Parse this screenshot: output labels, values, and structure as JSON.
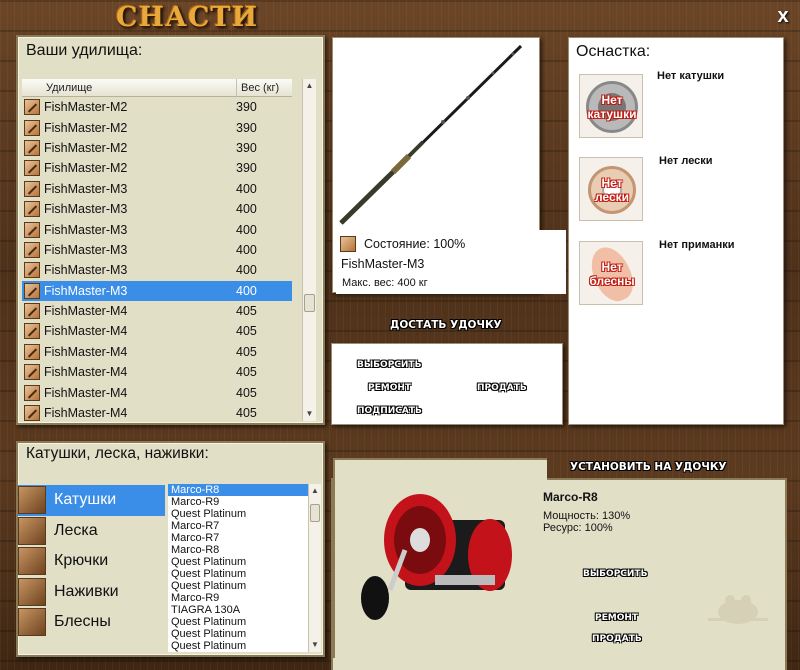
{
  "window": {
    "title": "СНАСТИ",
    "close_label": "x"
  },
  "rods": {
    "heading": "Ваши удилища:",
    "columns": [
      "Удилище",
      "Вес (кг)"
    ],
    "rows": [
      {
        "name": "FishMaster-M2",
        "weight": "390"
      },
      {
        "name": "FishMaster-M2",
        "weight": "390"
      },
      {
        "name": "FishMaster-M2",
        "weight": "390"
      },
      {
        "name": "FishMaster-M2",
        "weight": "390"
      },
      {
        "name": "FishMaster-M3",
        "weight": "400"
      },
      {
        "name": "FishMaster-M3",
        "weight": "400"
      },
      {
        "name": "FishMaster-M3",
        "weight": "400"
      },
      {
        "name": "FishMaster-M3",
        "weight": "400"
      },
      {
        "name": "FishMaster-M3",
        "weight": "400"
      },
      {
        "name": "FishMaster-M3",
        "weight": "400",
        "selected": true
      },
      {
        "name": "FishMaster-M4",
        "weight": "405"
      },
      {
        "name": "FishMaster-M4",
        "weight": "405"
      },
      {
        "name": "FishMaster-M4",
        "weight": "405"
      },
      {
        "name": "FishMaster-M4",
        "weight": "405"
      },
      {
        "name": "FishMaster-M4",
        "weight": "405"
      },
      {
        "name": "FishMaster-M4",
        "weight": "405"
      }
    ]
  },
  "rod_preview": {
    "state": "Состояние: 100%",
    "name": "FishMaster-M3",
    "max_weight": "Макс. вес: 400 кг"
  },
  "rod_actions": {
    "take_out": "ДОСТАТЬ УДОЧКУ",
    "discard": "ВЫБОРСИТЬ",
    "repair": "РЕМОНТ",
    "sell": "ПРОДАТЬ",
    "sign": "ПОДПИСАТЬ"
  },
  "tackle": {
    "heading": "Оснастка:",
    "slots": [
      {
        "label": "Нет катушки",
        "badge": [
          "Нет",
          "катушки"
        ]
      },
      {
        "label": "Нет лески",
        "badge": [
          "Нет",
          "лески"
        ]
      },
      {
        "label": "Нет приманки",
        "badge": [
          "Нет",
          "блесны"
        ]
      }
    ]
  },
  "categories": {
    "heading": "Катушки, леска, наживки:",
    "items": [
      {
        "label": "Катушки",
        "icon": "reel-icon",
        "selected": true
      },
      {
        "label": "Леска",
        "icon": "line-icon"
      },
      {
        "label": "Крючки",
        "icon": "hook-icon"
      },
      {
        "label": "Наживки",
        "icon": "bait-icon"
      },
      {
        "label": "Блесны",
        "icon": "lure-icon"
      }
    ],
    "list": [
      {
        "name": "Marco-R8",
        "selected": true
      },
      {
        "name": "Marco-R9"
      },
      {
        "name": "Quest Platinum"
      },
      {
        "name": "Marco-R7"
      },
      {
        "name": "Marco-R7"
      },
      {
        "name": "Marco-R8"
      },
      {
        "name": "Quest Platinum"
      },
      {
        "name": "Quest Platinum"
      },
      {
        "name": "Quest Platinum"
      },
      {
        "name": "Marco-R9"
      },
      {
        "name": "TIAGRA 130A"
      },
      {
        "name": "Quest Platinum"
      },
      {
        "name": "Quest Platinum"
      },
      {
        "name": "Quest Platinum"
      }
    ]
  },
  "selected_item": {
    "install": "УСТАНОВИТЬ НА УДОЧКУ",
    "name": "Marco-R8",
    "power": "Мощность: 130%",
    "resource": "Ресурс: 100%",
    "discard": "ВЫБОРСИТЬ",
    "repair": "РЕМОНТ",
    "sell": "ПРОДАТЬ"
  },
  "colors": {
    "selection": "#3a8ee8",
    "title": "#e9a83c",
    "panel": "#e2dfc7"
  }
}
